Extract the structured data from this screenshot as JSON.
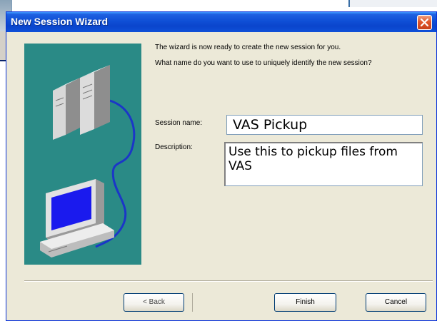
{
  "wizard": {
    "title": "New Session Wizard",
    "intro": "The wizard is now ready to create the new session for you.",
    "question": "What name do you want to use to uniquely identify the new session?",
    "session_name_label": "Session name:",
    "session_name_value": "VAS Pickup",
    "description_label": "Description:",
    "description_value": "Use this to pickup files from VAS"
  },
  "buttons": {
    "back": "< Back",
    "finish": "Finish",
    "cancel": "Cancel"
  },
  "icons": {
    "close": "close-icon",
    "server": "server-icon",
    "computer": "computer-icon"
  },
  "colors": {
    "titlebar": "#0a45cc",
    "art_panel": "#2a8a86",
    "close_button": "#e0552a",
    "dialog_face": "#ece9d8"
  }
}
